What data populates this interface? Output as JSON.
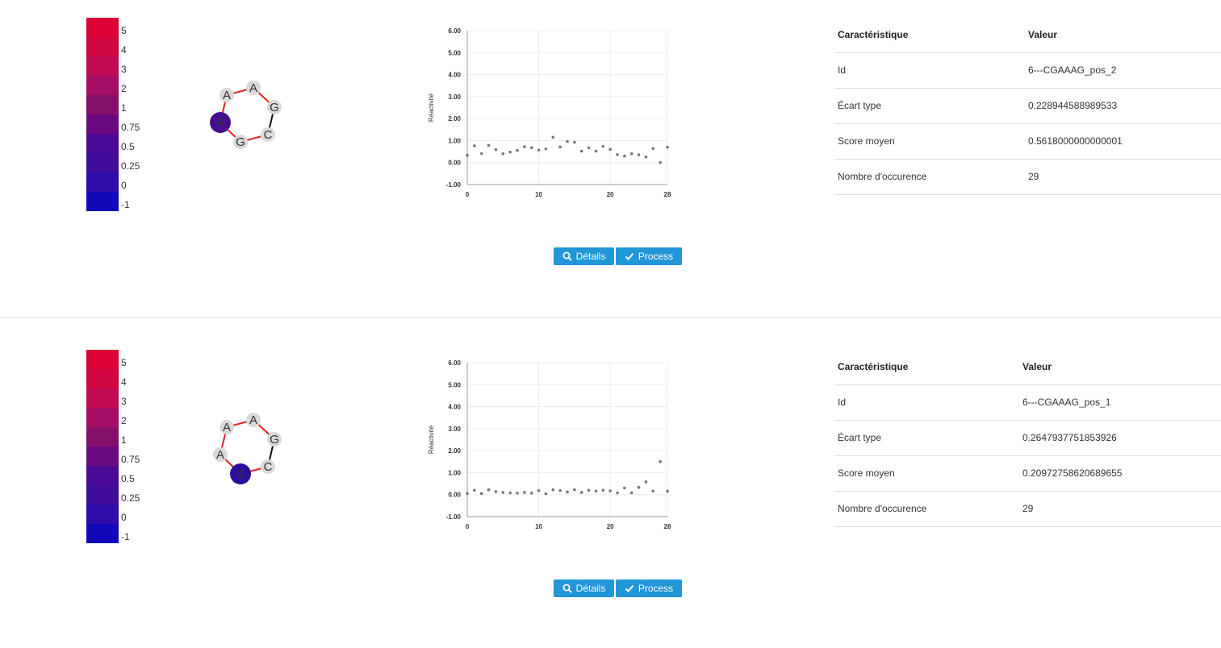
{
  "color_scale": {
    "labels": [
      "5",
      "4",
      "3",
      "2",
      "1",
      "0.75",
      "0.5",
      "0.25",
      "0",
      "-1"
    ],
    "colors": [
      "#dc0332",
      "#d00740",
      "#c00c55",
      "#a50e66",
      "#85106b",
      "#6a0a80",
      "#4b0a96",
      "#3f0c9a",
      "#2f0ba8",
      "#1209b9"
    ]
  },
  "panels": [
    {
      "motif": {
        "nucleotides": [
          "A",
          "A",
          "G",
          "C",
          "G",
          "A"
        ],
        "highlight_index": 5,
        "highlight_color": "#480d8f"
      },
      "chart_data": {
        "type": "scatter",
        "ylabel": "Réactivité",
        "xlabel": "",
        "xlim": [
          0,
          28
        ],
        "ylim": [
          -1,
          6
        ],
        "x_ticks": [
          "0",
          "10",
          "20",
          "28"
        ],
        "y_ticks": [
          "-1.00",
          "0.00",
          "1.00",
          "2.00",
          "3.00",
          "4.00",
          "5.00",
          "6.00"
        ],
        "x": [
          0,
          1,
          2,
          3,
          4,
          5,
          6,
          7,
          8,
          9,
          10,
          11,
          12,
          13,
          14,
          15,
          16,
          17,
          18,
          19,
          20,
          21,
          22,
          23,
          24,
          25,
          26,
          27,
          28
        ],
        "y": [
          0.33,
          0.76,
          0.41,
          0.78,
          0.59,
          0.4,
          0.48,
          0.55,
          0.72,
          0.68,
          0.57,
          0.62,
          1.15,
          0.71,
          0.96,
          0.92,
          0.52,
          0.67,
          0.52,
          0.74,
          0.6,
          0.36,
          0.3,
          0.4,
          0.35,
          0.26,
          0.64,
          0.0,
          0.7
        ]
      },
      "buttons": {
        "details": "Détails",
        "process": "Process"
      },
      "table": {
        "headers": [
          "Caractéristique",
          "Valeur"
        ],
        "rows": [
          [
            "Id",
            "6---CGAAAG_pos_2"
          ],
          [
            "Écart type",
            "0.228944588989533"
          ],
          [
            "Score moyen",
            "0.5618000000000001"
          ],
          [
            "Nombre d'occurence",
            "29"
          ]
        ]
      }
    },
    {
      "motif": {
        "nucleotides": [
          "A",
          "A",
          "G",
          "C",
          "G",
          "A"
        ],
        "highlight_index": 4,
        "highlight_color": "#2d0d9e"
      },
      "chart_data": {
        "type": "scatter",
        "ylabel": "Réactivité",
        "xlabel": "",
        "xlim": [
          0,
          28
        ],
        "ylim": [
          -1,
          6
        ],
        "x_ticks": [
          "0",
          "10",
          "20",
          "28"
        ],
        "y_ticks": [
          "-1.00",
          "0.00",
          "1.00",
          "2.00",
          "3.00",
          "4.00",
          "5.00",
          "6.00"
        ],
        "x": [
          0,
          1,
          2,
          3,
          4,
          5,
          6,
          7,
          8,
          9,
          10,
          11,
          12,
          13,
          14,
          15,
          16,
          17,
          18,
          19,
          20,
          21,
          22,
          23,
          24,
          25,
          26,
          27,
          28
        ],
        "y": [
          0.05,
          0.2,
          0.05,
          0.22,
          0.14,
          0.1,
          0.08,
          0.07,
          0.1,
          0.07,
          0.18,
          0.04,
          0.22,
          0.18,
          0.12,
          0.22,
          0.1,
          0.2,
          0.16,
          0.2,
          0.17,
          0.08,
          0.3,
          0.08,
          0.33,
          0.58,
          0.16,
          1.5,
          0.16
        ]
      },
      "buttons": {
        "details": "Détails",
        "process": "Process"
      },
      "table": {
        "headers": [
          "Caractéristique",
          "Valeur"
        ],
        "rows": [
          [
            "Id",
            "6---CGAAAG_pos_1"
          ],
          [
            "Écart type",
            "0.2647937751853926"
          ],
          [
            "Score moyen",
            "0.20972758620689655"
          ],
          [
            "Nombre d'occurence",
            "29"
          ]
        ]
      }
    }
  ]
}
